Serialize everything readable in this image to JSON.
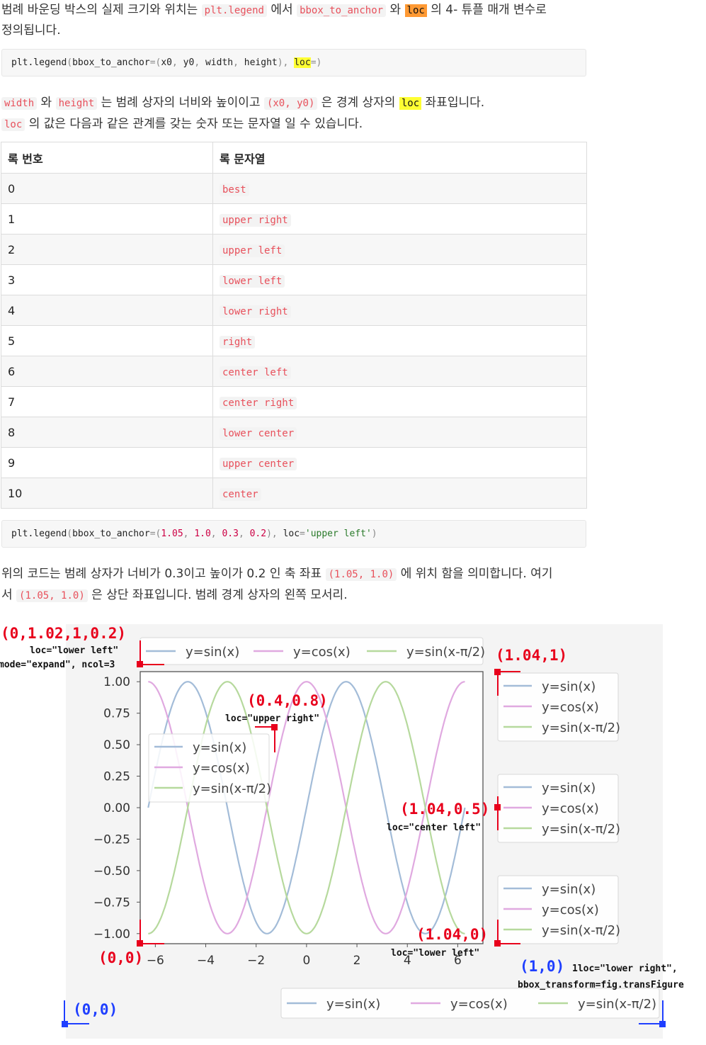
{
  "intro": {
    "t1": "범례 바운딩 박스의 실제 크기와 위치는 ",
    "c1": "plt.legend",
    "t2": " 에서 ",
    "c2": "bbox_to_anchor",
    "t3": " 와 ",
    "c3": "loc",
    "t4": " 의 4- 튜플 매개 변수로",
    "t5": "정의됩니다."
  },
  "code1": {
    "a": "plt.legend",
    "b": "(",
    "c": "bbox_to_anchor",
    "d": "=(",
    "e": "x0",
    "f": ", ",
    "g": "y0",
    "h": ", ",
    "i": "width",
    "j": ", ",
    "k": "height",
    "l": "), ",
    "m": "loc",
    "n": "=)"
  },
  "para2": {
    "c1": "width",
    "t1": " 와 ",
    "c2": "height",
    "t2": " 는 범례 상자의 너비와 높이이고 ",
    "c3": "(x0, y0)",
    "t3": " 은 경계 상자의 ",
    "c4": "loc",
    "t4": " 좌표입니다.",
    "c5": "loc",
    "t5": " 의 값은 다음과 같은 관계를 갖는 숫자 또는 문자열 일 수 있습니다."
  },
  "table": {
    "headers": [
      "록 번호",
      "록 문자열"
    ],
    "rows": [
      [
        "0",
        "best"
      ],
      [
        "1",
        "upper right"
      ],
      [
        "2",
        "upper left"
      ],
      [
        "3",
        "lower left"
      ],
      [
        "4",
        "lower right"
      ],
      [
        "5",
        "right"
      ],
      [
        "6",
        "center left"
      ],
      [
        "7",
        "center right"
      ],
      [
        "8",
        "lower center"
      ],
      [
        "9",
        "upper center"
      ],
      [
        "10",
        "center"
      ]
    ]
  },
  "code2": {
    "a": "plt.legend",
    "b": "(",
    "c": "bbox_to_anchor",
    "d": "=(",
    "e": "1.05",
    "f": ", ",
    "g": "1.0",
    "h": ", ",
    "i": "0.3",
    "j": ", ",
    "k": "0.2",
    "l": "), ",
    "m": "loc",
    "n": "=",
    "o": "'upper left'",
    "p": ")"
  },
  "para3": {
    "t1": "위의 코드는 범례 상자가 너비가 0.3이고 높이가 0.2 인 축 좌표 ",
    "c1": "(1.05, 1.0)",
    "t2": " 에 위치 함을 의미합니다. 여기",
    "t3": "서 ",
    "c2": "(1.05, 1.0)",
    "t4": " 은 상단 좌표입니다. 범례 경계 상자의 왼쪽 모서리."
  },
  "figure": {
    "colors": {
      "sin": "#a3bcd8",
      "cos": "#e0a9e0",
      "shift": "#b6d99d",
      "red": "#e8001c",
      "blue": "#1f3fff"
    },
    "legend_labels": [
      "y=sin(x)",
      "y=cos(x)",
      "y=sin(x-π/2)"
    ],
    "yticks": [
      "1.00",
      "0.75",
      "0.50",
      "0.25",
      "0.00",
      "−0.25",
      "−0.50",
      "−0.75",
      "−1.00"
    ],
    "xticks": [
      "−6",
      "−4",
      "−2",
      "0",
      "2",
      "4",
      "6"
    ],
    "ann": {
      "top_left_coord": "(0,1.02,1,0.2)",
      "top_left_loc": "loc=\"lower left\"",
      "top_left_mode": "mode=\"expand\", ncol=3",
      "upper_right_coord": "(0.4,0.8)",
      "upper_right_loc": "loc=\"upper right\"",
      "right_top_coord": "(1.04,1)",
      "center_left_coord": "(1.04,0.5)",
      "center_left_loc": "loc=\"center left\"",
      "lower_left_coord": "(1.04,0)",
      "lower_left_loc": "loc=\"lower left\"",
      "origin": "(0,0)",
      "fig_origin": "(0,0)",
      "fig_br_coord": "(1,0)",
      "fig_br_loc": "1loc=\"lower right\",",
      "fig_br_transform": "bbox_transform=fig.transFigure"
    }
  }
}
